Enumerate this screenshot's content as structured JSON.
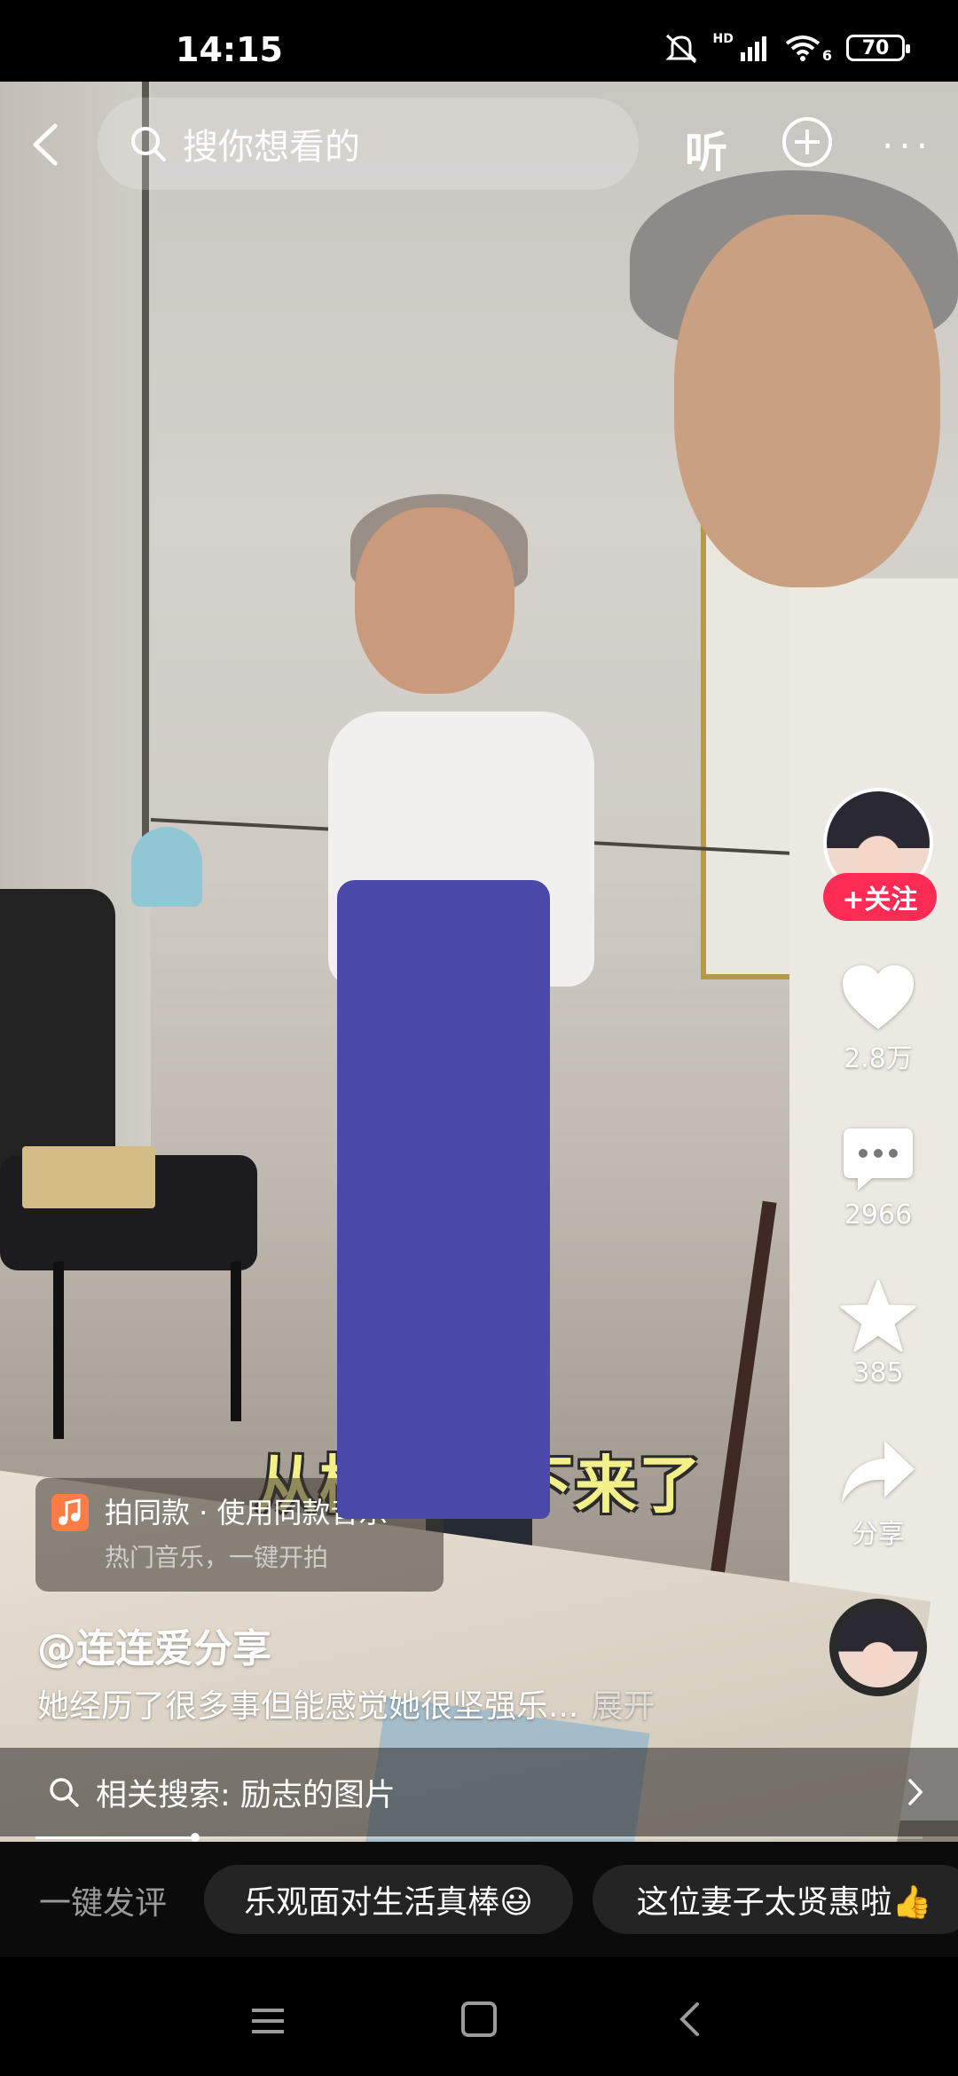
{
  "status_bar": {
    "time": "14:15",
    "network": "HD",
    "wifi": "6",
    "battery": "70"
  },
  "top_bar": {
    "search_placeholder": "搜你想看的",
    "listen_label": "听"
  },
  "video": {
    "subtitle": "从楼上掉下来了"
  },
  "actions": {
    "follow_label": "+关注",
    "likes": "2.8万",
    "comments": "2966",
    "favorites": "385",
    "share_label": "分享"
  },
  "music_card": {
    "title": "拍同款 · 使用同款音乐",
    "subtitle": "热门音乐，一键开拍"
  },
  "post": {
    "author": "@连连爱分享",
    "description": "她经历了很多事但能感觉她很坚强乐...",
    "expand_label": "展开"
  },
  "related_search": {
    "label": "相关搜索: 励志的图片"
  },
  "progress": {
    "played_fraction": 0.18
  },
  "quick_comments": {
    "label": "一键发评",
    "chips": [
      "乐观面对生活真棒😃",
      "这位妻子太贤惠啦👍"
    ]
  },
  "colors": {
    "follow_red": "#fe2c55",
    "subtitle_yellow": "#f3f08a"
  }
}
